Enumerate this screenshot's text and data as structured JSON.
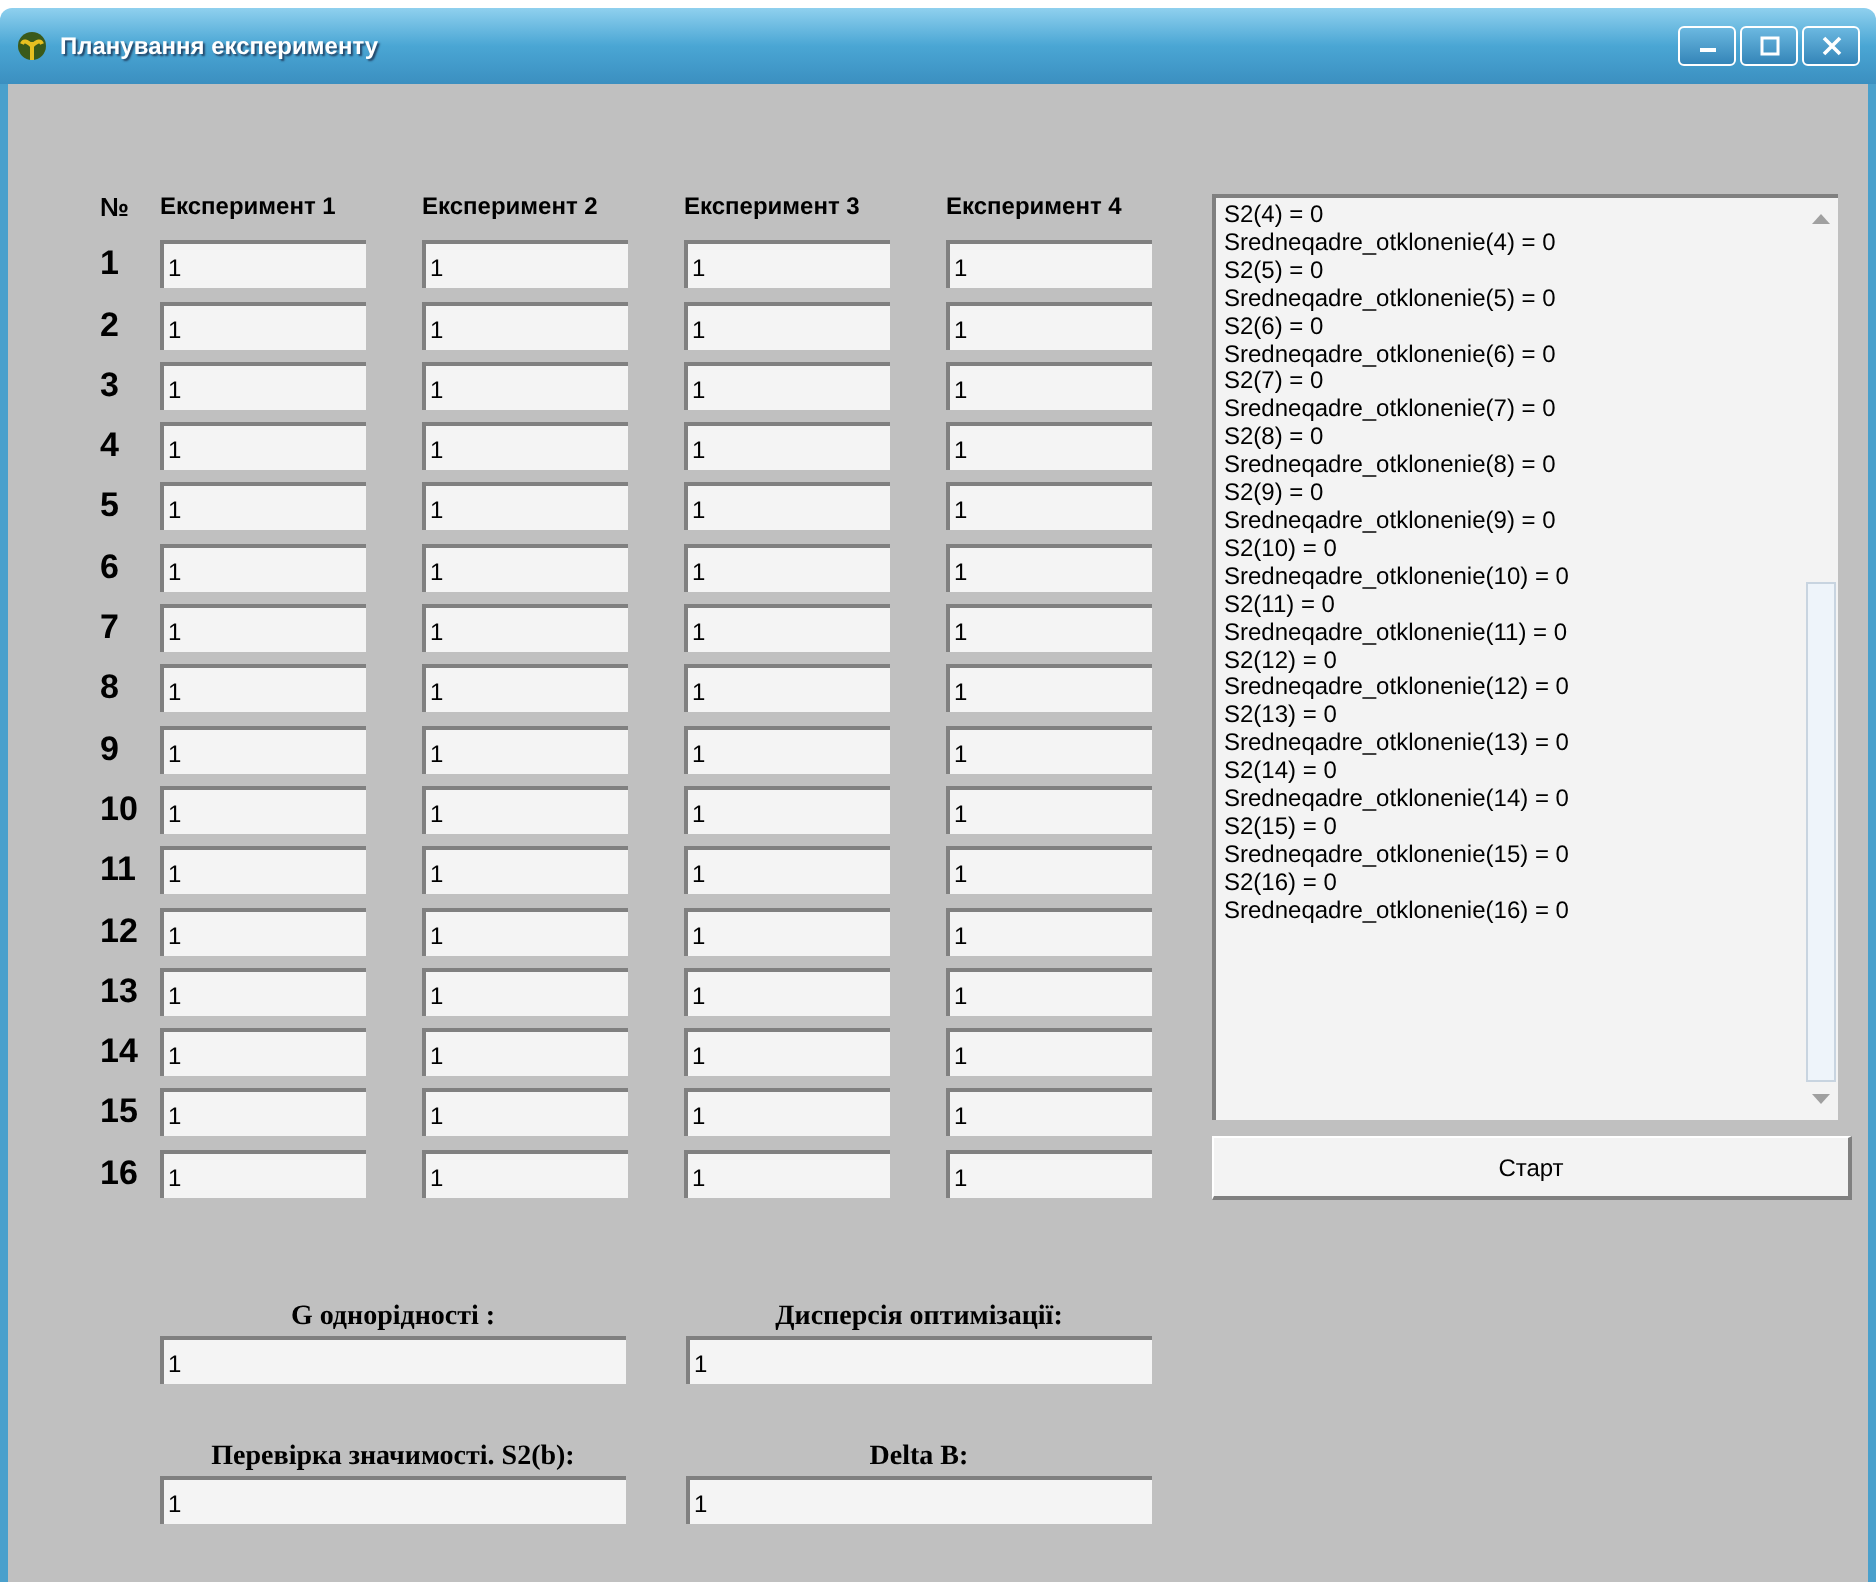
{
  "window": {
    "title": "Планування експерименту"
  },
  "grid": {
    "number_header": "№",
    "columns": [
      "Експеримент 1",
      "Експеримент 2",
      "Експеримент 3",
      "Експеримент 4"
    ],
    "rows": [
      {
        "number": "1",
        "values": [
          "1",
          "1",
          "1",
          "1"
        ]
      },
      {
        "number": "2",
        "values": [
          "1",
          "1",
          "1",
          "1"
        ]
      },
      {
        "number": "3",
        "values": [
          "1",
          "1",
          "1",
          "1"
        ]
      },
      {
        "number": "4",
        "values": [
          "1",
          "1",
          "1",
          "1"
        ]
      },
      {
        "number": "5",
        "values": [
          "1",
          "1",
          "1",
          "1"
        ]
      },
      {
        "number": "6",
        "values": [
          "1",
          "1",
          "1",
          "1"
        ]
      },
      {
        "number": "7",
        "values": [
          "1",
          "1",
          "1",
          "1"
        ]
      },
      {
        "number": "8",
        "values": [
          "1",
          "1",
          "1",
          "1"
        ]
      },
      {
        "number": "9",
        "values": [
          "1",
          "1",
          "1",
          "1"
        ]
      },
      {
        "number": "10",
        "values": [
          "1",
          "1",
          "1",
          "1"
        ]
      },
      {
        "number": "11",
        "values": [
          "1",
          "1",
          "1",
          "1"
        ]
      },
      {
        "number": "12",
        "values": [
          "1",
          "1",
          "1",
          "1"
        ]
      },
      {
        "number": "13",
        "values": [
          "1",
          "1",
          "1",
          "1"
        ]
      },
      {
        "number": "14",
        "values": [
          "1",
          "1",
          "1",
          "1"
        ]
      },
      {
        "number": "15",
        "values": [
          "1",
          "1",
          "1",
          "1"
        ]
      },
      {
        "number": "16",
        "values": [
          "1",
          "1",
          "1",
          "1"
        ]
      }
    ]
  },
  "log": [
    "S2(4) = 0",
    "Sredneqadre_otklonenie(4) = 0",
    "S2(5) = 0",
    "Sredneqadre_otklonenie(5) = 0",
    "S2(6) = 0",
    "Sredneqadre_otklonenie(6) = 0",
    "S2(7) = 0",
    "Sredneqadre_otklonenie(7) = 0",
    "S2(8) = 0",
    "Sredneqadre_otklonenie(8) = 0",
    "S2(9) = 0",
    "Sredneqadre_otklonenie(9) = 0",
    "S2(10) = 0",
    "Sredneqadre_otklonenie(10) = 0",
    "S2(11) = 0",
    "Sredneqadre_otklonenie(11) = 0",
    "S2(12) = 0",
    "Sredneqadre_otklonenie(12) = 0",
    "S2(13) = 0",
    "Sredneqadre_otklonenie(13) = 0",
    "S2(14) = 0",
    "Sredneqadre_otklonenie(14) = 0",
    "S2(15) = 0",
    "Sredneqadre_otklonenie(15) = 0",
    "S2(16) = 0",
    "Sredneqadre_otklonenie(16) = 0"
  ],
  "start_button": "Старт",
  "results": [
    {
      "label": "G однорідності :",
      "value": "1"
    },
    {
      "label": "Дисперсія оптимізації:",
      "value": "1"
    },
    {
      "label": "Перевірка значимості. S2(b):",
      "value": "1"
    },
    {
      "label": "Delta B:",
      "value": "1"
    }
  ]
}
